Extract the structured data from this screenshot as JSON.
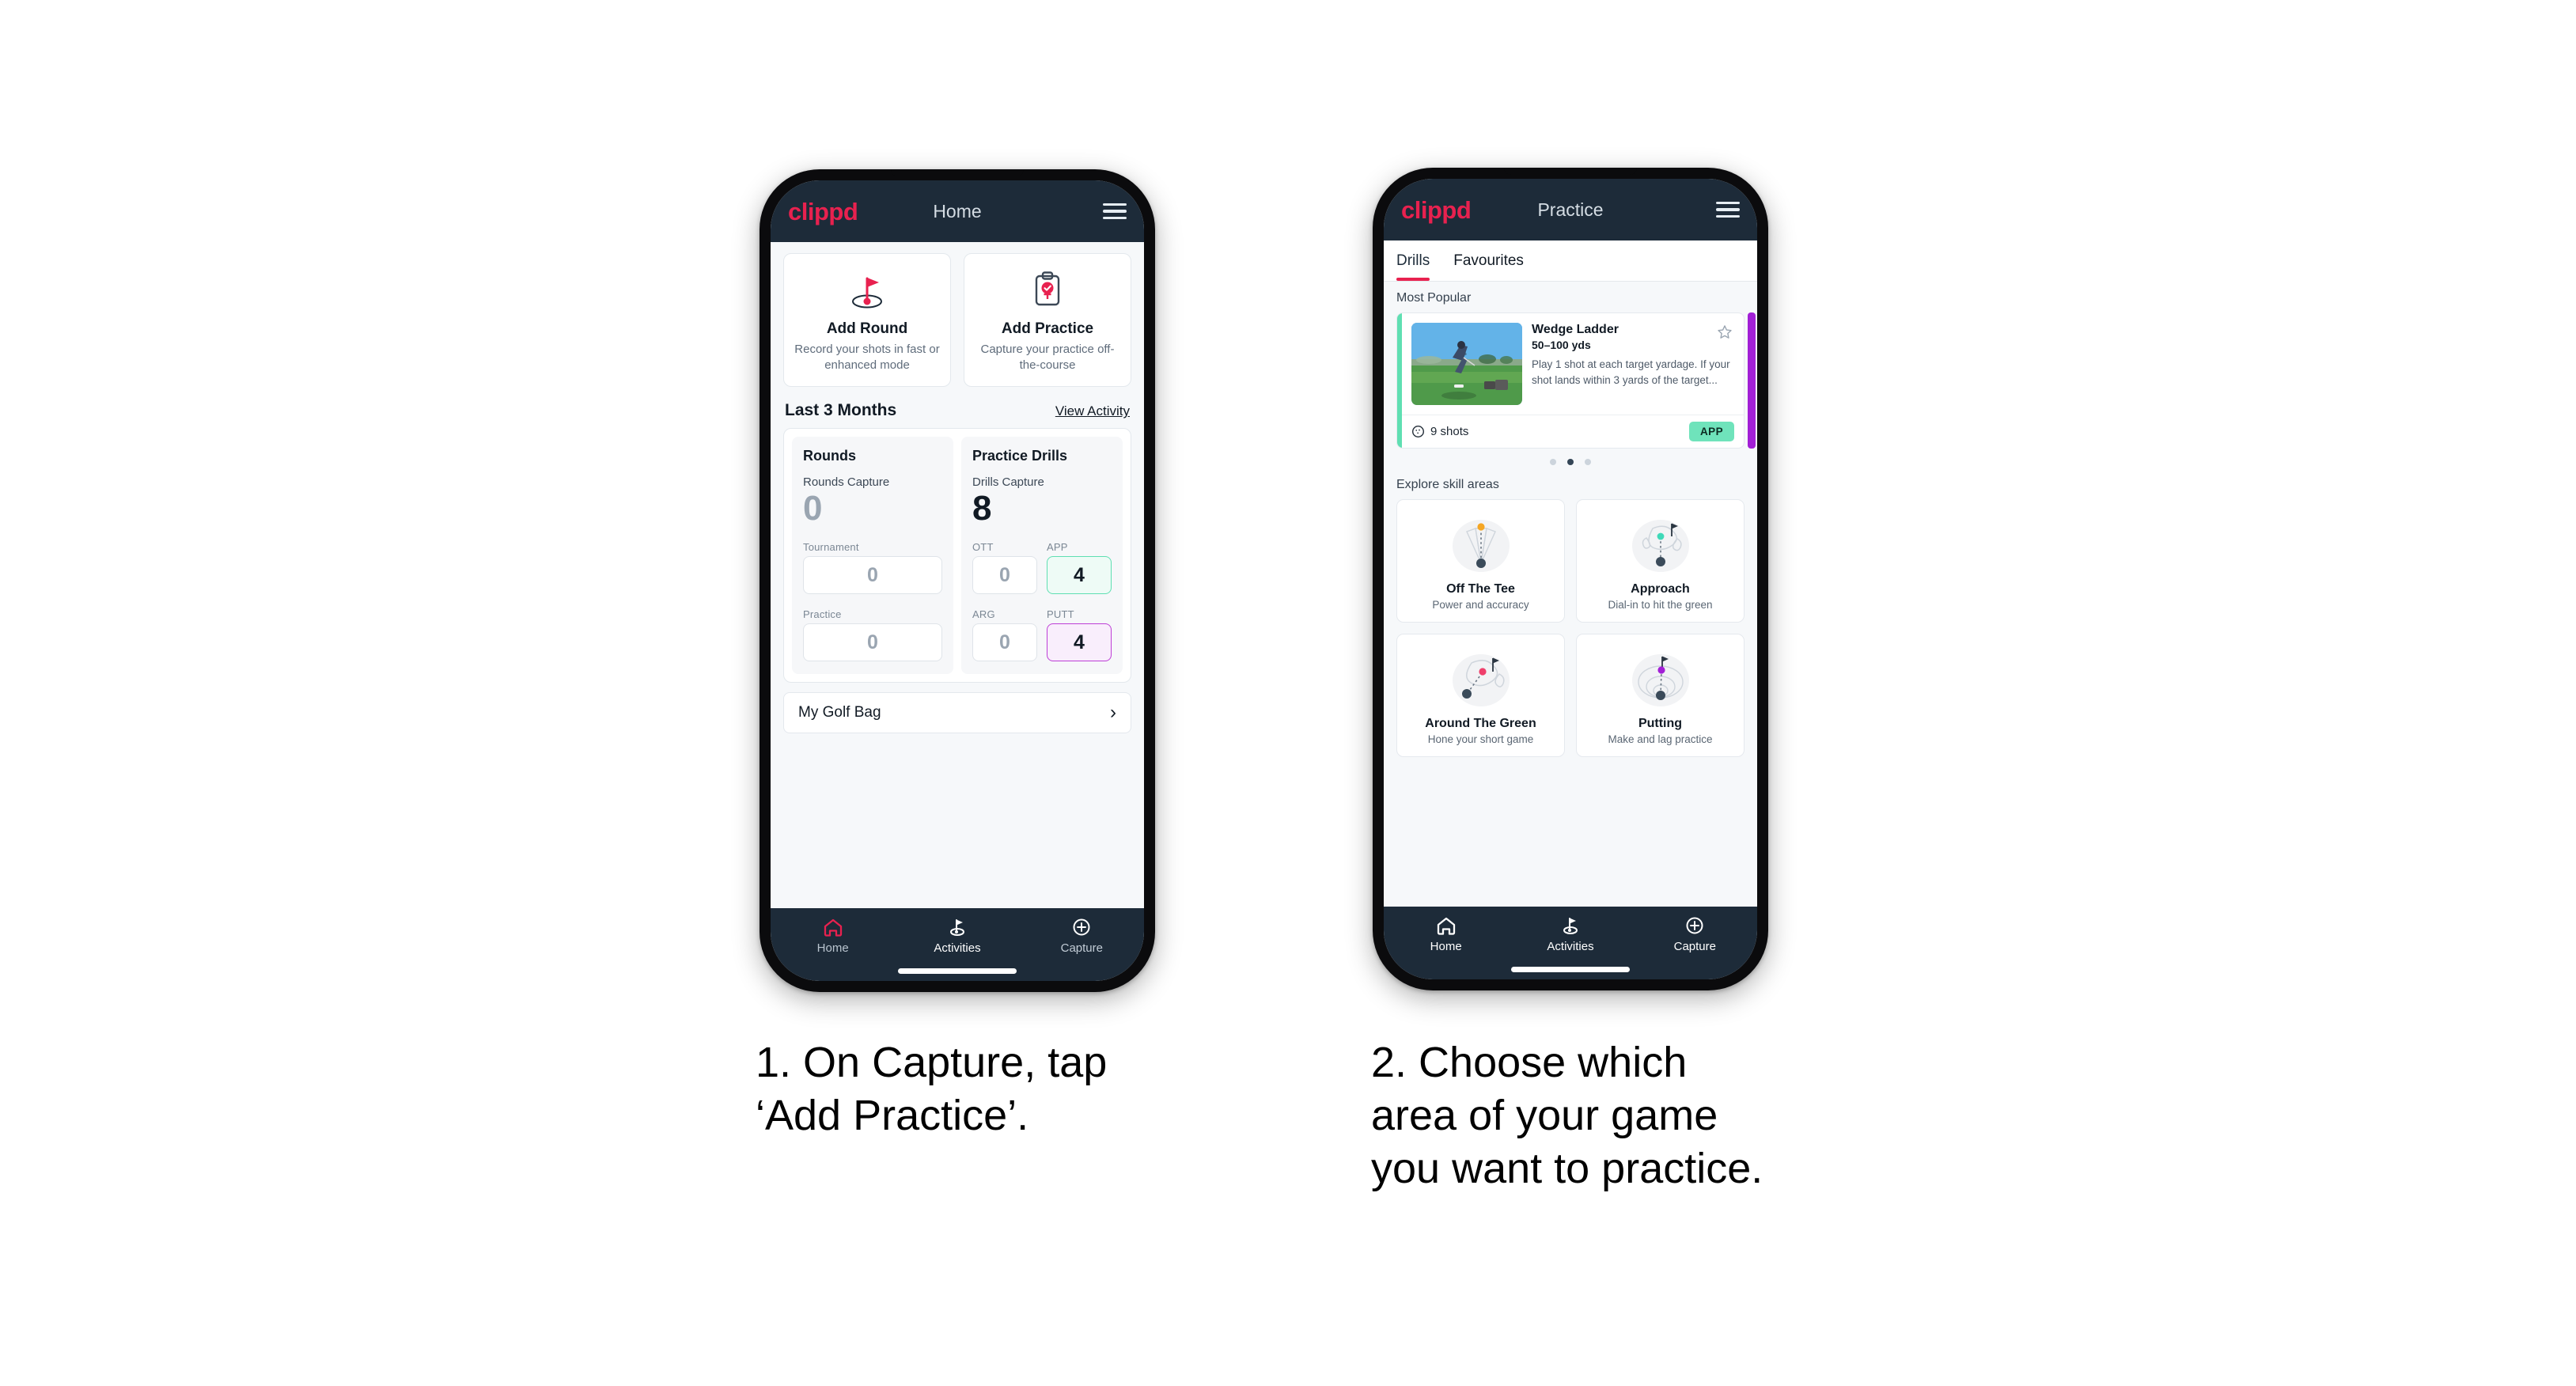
{
  "brand": {
    "logo": "clippd",
    "accent": "#e8214f",
    "navy": "#1d2b39"
  },
  "phone1": {
    "appbar": {
      "title": "Home",
      "menu_icon": "hamburger-icon"
    },
    "quick_actions": [
      {
        "icon": "golf-flag-icon",
        "title": "Add Round",
        "subtitle": "Record your shots in fast or enhanced mode"
      },
      {
        "icon": "clipboard-check-icon",
        "title": "Add Practice",
        "subtitle": "Capture your practice off-the-course"
      }
    ],
    "section": {
      "title": "Last 3 Months",
      "action": "View Activity"
    },
    "stats": {
      "rounds": {
        "heading": "Rounds",
        "capture_label": "Rounds Capture",
        "capture_value": "0",
        "metrics": [
          {
            "label": "Tournament",
            "value": "0",
            "style": "plain"
          },
          {
            "label": "Practice",
            "value": "0",
            "style": "plain"
          }
        ]
      },
      "drills": {
        "heading": "Practice Drills",
        "capture_label": "Drills Capture",
        "capture_value": "8",
        "metrics": [
          {
            "label": "OTT",
            "value": "0",
            "style": "plain"
          },
          {
            "label": "APP",
            "value": "4",
            "style": "app"
          },
          {
            "label": "ARG",
            "value": "0",
            "style": "plain"
          },
          {
            "label": "PUTT",
            "value": "4",
            "style": "putt"
          }
        ]
      }
    },
    "golf_bag": {
      "label": "My Golf Bag",
      "chevron": "chevron-right-icon"
    },
    "bottom_nav": [
      {
        "icon": "home-icon",
        "label": "Home",
        "active": true
      },
      {
        "icon": "golf-flag-icon",
        "label": "Activities",
        "active": false
      },
      {
        "icon": "plus-circle-icon",
        "label": "Capture",
        "active": false
      }
    ]
  },
  "phone2": {
    "appbar": {
      "title": "Practice",
      "menu_icon": "hamburger-icon"
    },
    "tabs": [
      {
        "label": "Drills",
        "selected": true
      },
      {
        "label": "Favourites",
        "selected": false
      }
    ],
    "most_popular": {
      "label": "Most Popular",
      "drill": {
        "title": "Wedge Ladder",
        "yardage": "50–100 yds",
        "description": "Play 1 shot at each target yardage. If your shot lands within 3 yards of the target...",
        "shots": "9 shots",
        "shots_icon": "golf-ball-icon",
        "chip": "APP",
        "chip_color": "#6fe3bb",
        "accent_color": "#5fdfb2",
        "favourite_icon": "star-outline-icon",
        "thumbnail": "golfer-chipping-photo"
      },
      "next_card_accent": "#a21fd6",
      "pagination": {
        "count": 3,
        "active_index": 1
      }
    },
    "skill_areas": {
      "label": "Explore skill areas",
      "items": [
        {
          "icon": "tee-shot-dispersion-icon",
          "name": "Off The Tee",
          "desc": "Power and accuracy",
          "dot_color": "#f5a623"
        },
        {
          "icon": "green-approach-icon",
          "name": "Approach",
          "desc": "Dial-in to hit the green",
          "dot_color": "#3fd9b8"
        },
        {
          "icon": "chip-around-green-icon",
          "name": "Around The Green",
          "desc": "Hone your short game",
          "dot_color": "#ef3f6b"
        },
        {
          "icon": "putting-rings-icon",
          "name": "Putting",
          "desc": "Make and lag practice",
          "dot_color": "#a21fd6"
        }
      ]
    },
    "bottom_nav": [
      {
        "icon": "home-icon",
        "label": "Home",
        "active": false
      },
      {
        "icon": "golf-flag-icon",
        "label": "Activities",
        "active": false
      },
      {
        "icon": "plus-circle-icon",
        "label": "Capture",
        "active": false
      }
    ]
  },
  "captions": [
    "1. On Capture, tap\n‘Add Practice’.",
    "2. Choose which\narea of your game\nyou want to practice."
  ]
}
